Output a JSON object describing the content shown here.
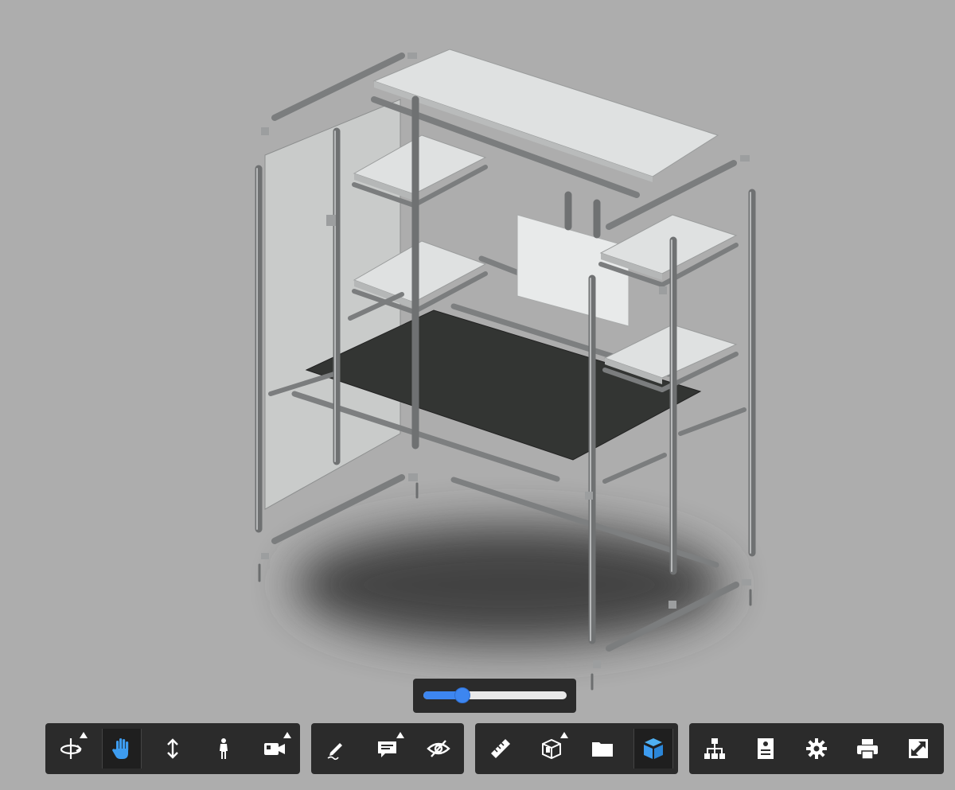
{
  "viewer": {
    "background": "#adadad",
    "accent": "#3d86f0",
    "icon_color": "#ffffff"
  },
  "explode_slider": {
    "value": 0.27
  },
  "toolbars": [
    {
      "id": "navigation",
      "tools": [
        {
          "name": "orbit-icon",
          "active": false,
          "flyout": true
        },
        {
          "name": "pan-icon",
          "active": true,
          "flyout": false
        },
        {
          "name": "zoom-icon",
          "active": false,
          "flyout": false
        },
        {
          "name": "first-person-icon",
          "active": false,
          "flyout": false
        },
        {
          "name": "camera-icon",
          "active": false,
          "flyout": true
        }
      ]
    },
    {
      "id": "review",
      "tools": [
        {
          "name": "markup-pencil-icon",
          "active": false,
          "flyout": false
        },
        {
          "name": "comment-icon",
          "active": false,
          "flyout": true
        },
        {
          "name": "hide-eye-icon",
          "active": false,
          "flyout": false
        }
      ]
    },
    {
      "id": "analysis",
      "tools": [
        {
          "name": "measure-ruler-icon",
          "active": false,
          "flyout": false
        },
        {
          "name": "section-box-icon",
          "active": false,
          "flyout": true
        },
        {
          "name": "folder-icon",
          "active": false,
          "flyout": false
        },
        {
          "name": "explode-cube-icon",
          "active": true,
          "flyout": false
        }
      ]
    },
    {
      "id": "settings",
      "tools": [
        {
          "name": "model-browser-icon",
          "active": false,
          "flyout": false
        },
        {
          "name": "properties-icon",
          "active": false,
          "flyout": false
        },
        {
          "name": "settings-gear-icon",
          "active": false,
          "flyout": false
        },
        {
          "name": "print-icon",
          "active": false,
          "flyout": false
        },
        {
          "name": "fullscreen-icon",
          "active": false,
          "flyout": false
        }
      ]
    }
  ]
}
